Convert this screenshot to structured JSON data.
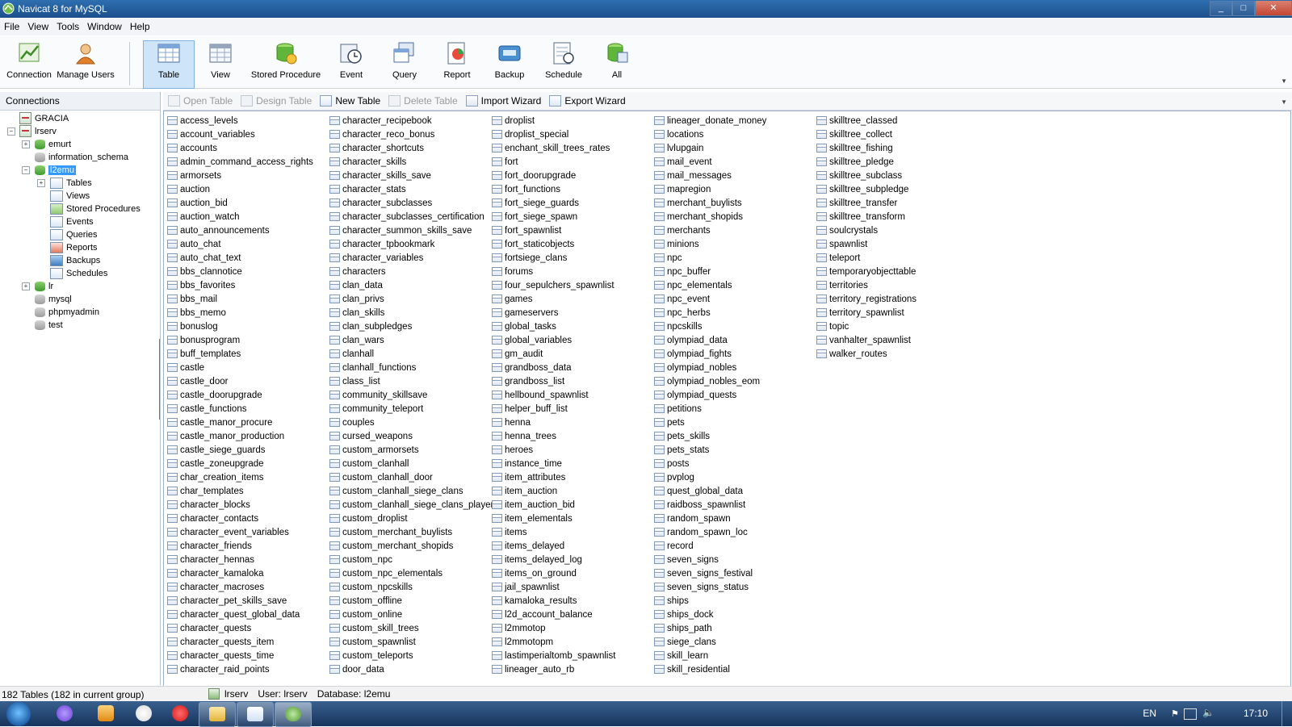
{
  "window": {
    "title": "Navicat 8 for MySQL",
    "min": "_",
    "max": "□",
    "close": "✕"
  },
  "menu": [
    "File",
    "View",
    "Tools",
    "Window",
    "Help"
  ],
  "toolbar": {
    "connection": "Connection",
    "manage_users": "Manage Users",
    "table": "Table",
    "view": "View",
    "stored_procedure": "Stored Procedure",
    "event": "Event",
    "query": "Query",
    "report": "Report",
    "backup": "Backup",
    "schedule": "Schedule",
    "all": "All"
  },
  "connections": {
    "header": "Connections",
    "gracia": "GRACIA",
    "lrserv": "lrserv",
    "emurt": "emurt",
    "information_schema": "information_schema",
    "l2emu": "l2emu",
    "tables": "Tables",
    "views": "Views",
    "stored_procedures": "Stored Procedures",
    "events": "Events",
    "queries": "Queries",
    "reports": "Reports",
    "backups": "Backups",
    "schedules": "Schedules",
    "lr": "lr",
    "mysql": "mysql",
    "phpmyadmin": "phpmyadmin",
    "test": "test"
  },
  "object_bar": {
    "open_table": "Open Table",
    "design_table": "Design Table",
    "new_table": "New Table",
    "delete_table": "Delete Table",
    "import_wizard": "Import Wizard",
    "export_wizard": "Export Wizard"
  },
  "tables": [
    [
      "access_levels",
      "account_variables",
      "accounts",
      "admin_command_access_rights",
      "armorsets",
      "auction",
      "auction_bid",
      "auction_watch",
      "auto_announcements",
      "auto_chat",
      "auto_chat_text",
      "bbs_clannotice",
      "bbs_favorites",
      "bbs_mail",
      "bbs_memo",
      "bonuslog",
      "bonusprogram",
      "buff_templates",
      "castle",
      "castle_door",
      "castle_doorupgrade",
      "castle_functions",
      "castle_manor_procure",
      "castle_manor_production",
      "castle_siege_guards",
      "castle_zoneupgrade",
      "char_creation_items",
      "char_templates",
      "character_blocks",
      "character_contacts",
      "character_event_variables",
      "character_friends",
      "character_hennas",
      "character_kamaloka",
      "character_macroses",
      "character_pet_skills_save",
      "character_quest_global_data",
      "character_quests",
      "character_quests_item",
      "character_quests_time",
      "character_raid_points"
    ],
    [
      "character_recipebook",
      "character_reco_bonus",
      "character_shortcuts",
      "character_skills",
      "character_skills_save",
      "character_stats",
      "character_subclasses",
      "character_subclasses_certification",
      "character_summon_skills_save",
      "character_tpbookmark",
      "character_variables",
      "characters",
      "clan_data",
      "clan_privs",
      "clan_skills",
      "clan_subpledges",
      "clan_wars",
      "clanhall",
      "clanhall_functions",
      "class_list",
      "community_skillsave",
      "community_teleport",
      "couples",
      "cursed_weapons",
      "custom_armorsets",
      "custom_clanhall",
      "custom_clanhall_door",
      "custom_clanhall_siege_clans",
      "custom_clanhall_siege_clans_players",
      "custom_droplist",
      "custom_merchant_buylists",
      "custom_merchant_shopids",
      "custom_npc",
      "custom_npc_elementals",
      "custom_npcskills",
      "custom_offline",
      "custom_online",
      "custom_skill_trees",
      "custom_spawnlist",
      "custom_teleports",
      "door_data"
    ],
    [
      "droplist",
      "droplist_special",
      "enchant_skill_trees_rates",
      "fort",
      "fort_doorupgrade",
      "fort_functions",
      "fort_siege_guards",
      "fort_siege_spawn",
      "fort_spawnlist",
      "fort_staticobjects",
      "fortsiege_clans",
      "forums",
      "four_sepulchers_spawnlist",
      "games",
      "gameservers",
      "global_tasks",
      "global_variables",
      "gm_audit",
      "grandboss_data",
      "grandboss_list",
      "hellbound_spawnlist",
      "helper_buff_list",
      "henna",
      "henna_trees",
      "heroes",
      "instance_time",
      "item_attributes",
      "item_auction",
      "item_auction_bid",
      "item_elementals",
      "items",
      "items_delayed",
      "items_delayed_log",
      "items_on_ground",
      "jail_spawnlist",
      "kamaloka_results",
      "l2d_account_balance",
      "l2mmotop",
      "l2mmotopm",
      "lastimperialtomb_spawnlist",
      "lineager_auto_rb"
    ],
    [
      "lineager_donate_money",
      "locations",
      "lvlupgain",
      "mail_event",
      "mail_messages",
      "mapregion",
      "merchant_buylists",
      "merchant_shopids",
      "merchants",
      "minions",
      "npc",
      "npc_buffer",
      "npc_elementals",
      "npc_event",
      "npc_herbs",
      "npcskills",
      "olympiad_data",
      "olympiad_fights",
      "olympiad_nobles",
      "olympiad_nobles_eom",
      "olympiad_quests",
      "petitions",
      "pets",
      "pets_skills",
      "pets_stats",
      "posts",
      "pvplog",
      "quest_global_data",
      "raidboss_spawnlist",
      "random_spawn",
      "random_spawn_loc",
      "record",
      "seven_signs",
      "seven_signs_festival",
      "seven_signs_status",
      "ships",
      "ships_dock",
      "ships_path",
      "siege_clans",
      "skill_learn",
      "skill_residential"
    ],
    [
      "skilltree_classed",
      "skilltree_collect",
      "skilltree_fishing",
      "skilltree_pledge",
      "skilltree_subclass",
      "skilltree_subpledge",
      "skilltree_transfer",
      "skilltree_transform",
      "soulcrystals",
      "spawnlist",
      "teleport",
      "temporaryobjecttable",
      "territories",
      "territory_registrations",
      "territory_spawnlist",
      "topic",
      "vanhalter_spawnlist",
      "walker_routes"
    ]
  ],
  "status": {
    "count": "182 Tables (182 in current group)",
    "server": "lrserv",
    "user": "User: lrserv",
    "database": "Database: l2emu"
  },
  "taskbar": {
    "lang": "EN",
    "clock": "17:10",
    "flag": "⚑",
    "volume": "🔈"
  },
  "colors": {
    "title_bar": "#1c4f8c",
    "selection": "#3399ff",
    "taskbar": "#16345d"
  }
}
